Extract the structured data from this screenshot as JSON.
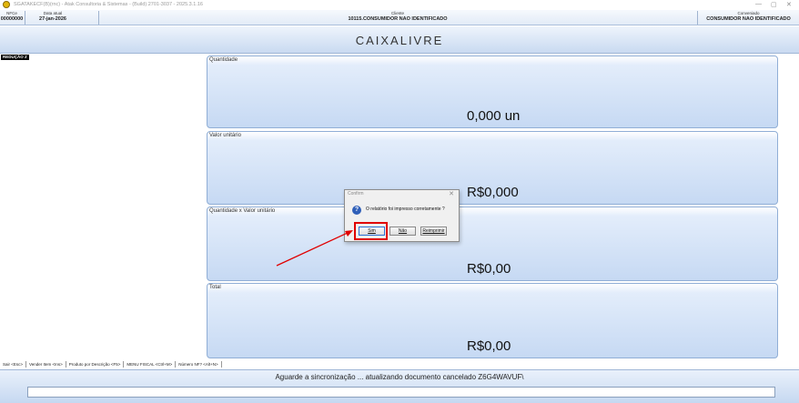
{
  "window": {
    "title": "SGATAKECF(B)(rnc) - Atak Consultoria & Sistemas - (Build) 2701-3037 - 2025.3.1.16",
    "controls": [
      "—",
      "▢",
      "✕"
    ]
  },
  "infobar": {
    "nfce_label": "NFCe",
    "nfce_value": "00000000",
    "date_label": "Data atual",
    "date_value": "27-jan-2026",
    "client_label": "Cliente",
    "client_value": "10115.CONSUMIDOR NAO IDENTIFICADO",
    "agreement_label": "Conveniado",
    "agreement_value": "CONSUMIDOR NAO IDENTIFICADO"
  },
  "banner": {
    "text": "CAIXALIVRE"
  },
  "left": {
    "reducao": "REDUÇÃO Z"
  },
  "panels": [
    {
      "label": "Quantidade",
      "value": "0,000 un"
    },
    {
      "label": "Valor unitário",
      "value": "R$0,000"
    },
    {
      "label": "Quantidade x Valor unitário",
      "value": "R$0,00"
    },
    {
      "label": "Total",
      "value": "R$0,00"
    }
  ],
  "shortcuts": [
    "Sair <Esc>",
    "Vender Item <Ins>",
    "Produto por Descrição <F5>",
    "MENU FISCAL <Ctrl+M>",
    "Número NF? <Alt+N>"
  ],
  "status": {
    "message": "Aguarde a sincronização ... atualizando documento cancelado Z6G4WAVUF\\"
  },
  "dialog": {
    "title": "Confirm",
    "close": "✕",
    "icon": "question-icon",
    "message": "O relatório foi impresso corretamente ?",
    "buttons": {
      "yes": "Sim",
      "no": "Não",
      "reprint": "Reimprimir"
    }
  },
  "colors": {
    "panel_border": "#90aed6",
    "highlight": "#e00000",
    "question_icon": "#2f5fb8"
  }
}
